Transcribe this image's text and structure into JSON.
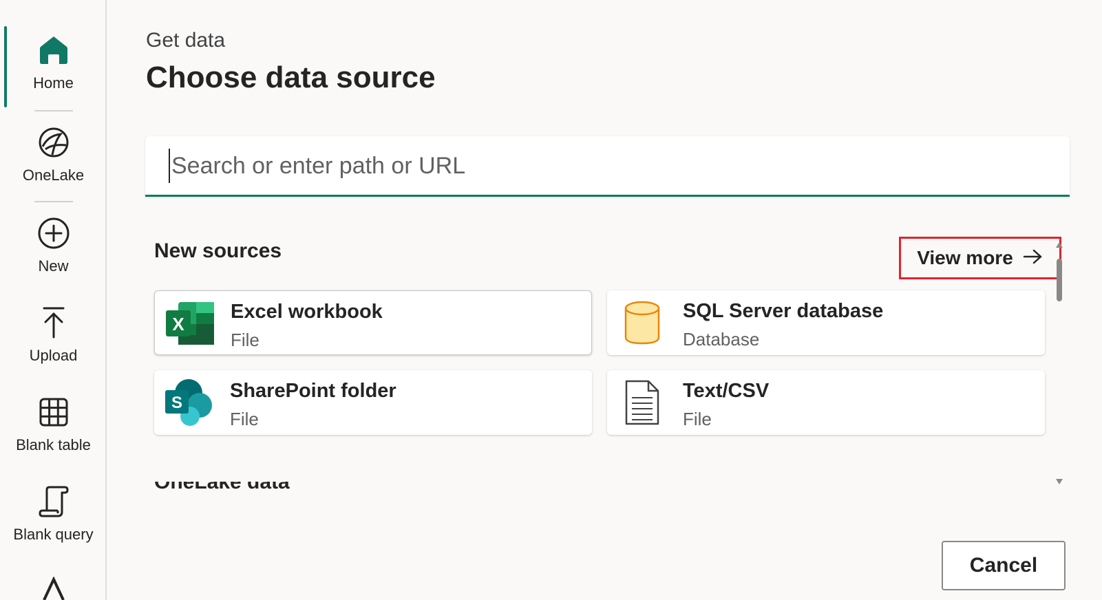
{
  "sidebar": {
    "items": [
      {
        "id": "home",
        "label": "Home",
        "icon": "home-icon",
        "active": true
      },
      {
        "id": "onelake",
        "label": "OneLake",
        "icon": "onelake-icon"
      },
      {
        "id": "new",
        "label": "New",
        "icon": "plus-circle-icon"
      },
      {
        "id": "upload",
        "label": "Upload",
        "icon": "upload-icon"
      },
      {
        "id": "blank-table",
        "label": "Blank table",
        "icon": "table-grid-icon"
      },
      {
        "id": "blank-query",
        "label": "Blank query",
        "icon": "script-icon"
      }
    ]
  },
  "header": {
    "kicker": "Get data",
    "title": "Choose data source"
  },
  "search": {
    "placeholder": "Search or enter path or URL",
    "value": ""
  },
  "new_sources": {
    "title": "New sources",
    "view_more_label": "View more",
    "cards": [
      {
        "name": "Excel workbook",
        "type": "File",
        "icon": "excel-icon",
        "selected": true
      },
      {
        "name": "SQL Server database",
        "type": "Database",
        "icon": "database-icon"
      },
      {
        "name": "SharePoint folder",
        "type": "File",
        "icon": "sharepoint-icon"
      },
      {
        "name": "Text/CSV",
        "type": "File",
        "icon": "document-icon"
      }
    ]
  },
  "next_section_partial": "OneLake data hub",
  "footer": {
    "cancel_label": "Cancel"
  },
  "colors": {
    "accent": "#117865",
    "highlight": "#e3222b",
    "background": "#faf9f8"
  }
}
